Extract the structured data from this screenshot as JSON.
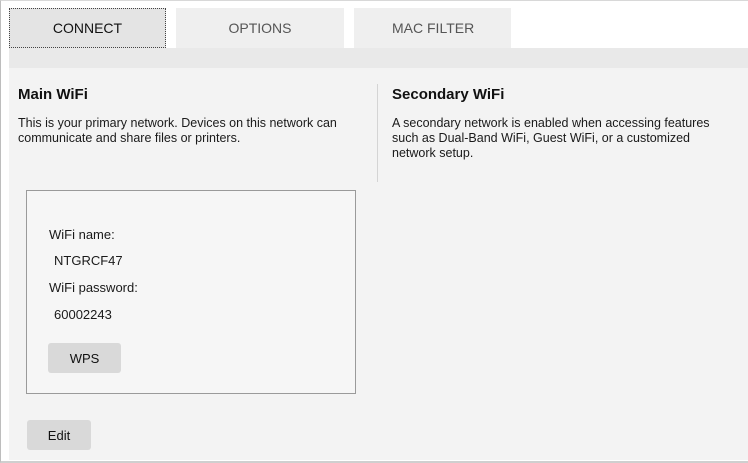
{
  "tabs": [
    {
      "label": "CONNECT",
      "active": true
    },
    {
      "label": "OPTIONS",
      "active": false
    },
    {
      "label": "MAC FILTER",
      "active": false
    }
  ],
  "main_wifi": {
    "title": "Main WiFi",
    "description": "This is your primary network. Devices on this network can communicate and share files or printers.",
    "name_label": "WiFi name:",
    "name_value": "NTGRCF47",
    "password_label": "WiFi password:",
    "password_value": "60002243",
    "wps_label": "WPS"
  },
  "secondary_wifi": {
    "title": "Secondary WiFi",
    "description": "A secondary network is enabled when accessing features such as Dual-Band WiFi, Guest WiFi, or a customized network setup."
  },
  "edit_label": "Edit",
  "colors": {
    "tab_bg": "#efefef",
    "content_bg": "#f3f3f3",
    "button_bg": "#d9d9d9",
    "box_border": "#9a9a9a"
  }
}
